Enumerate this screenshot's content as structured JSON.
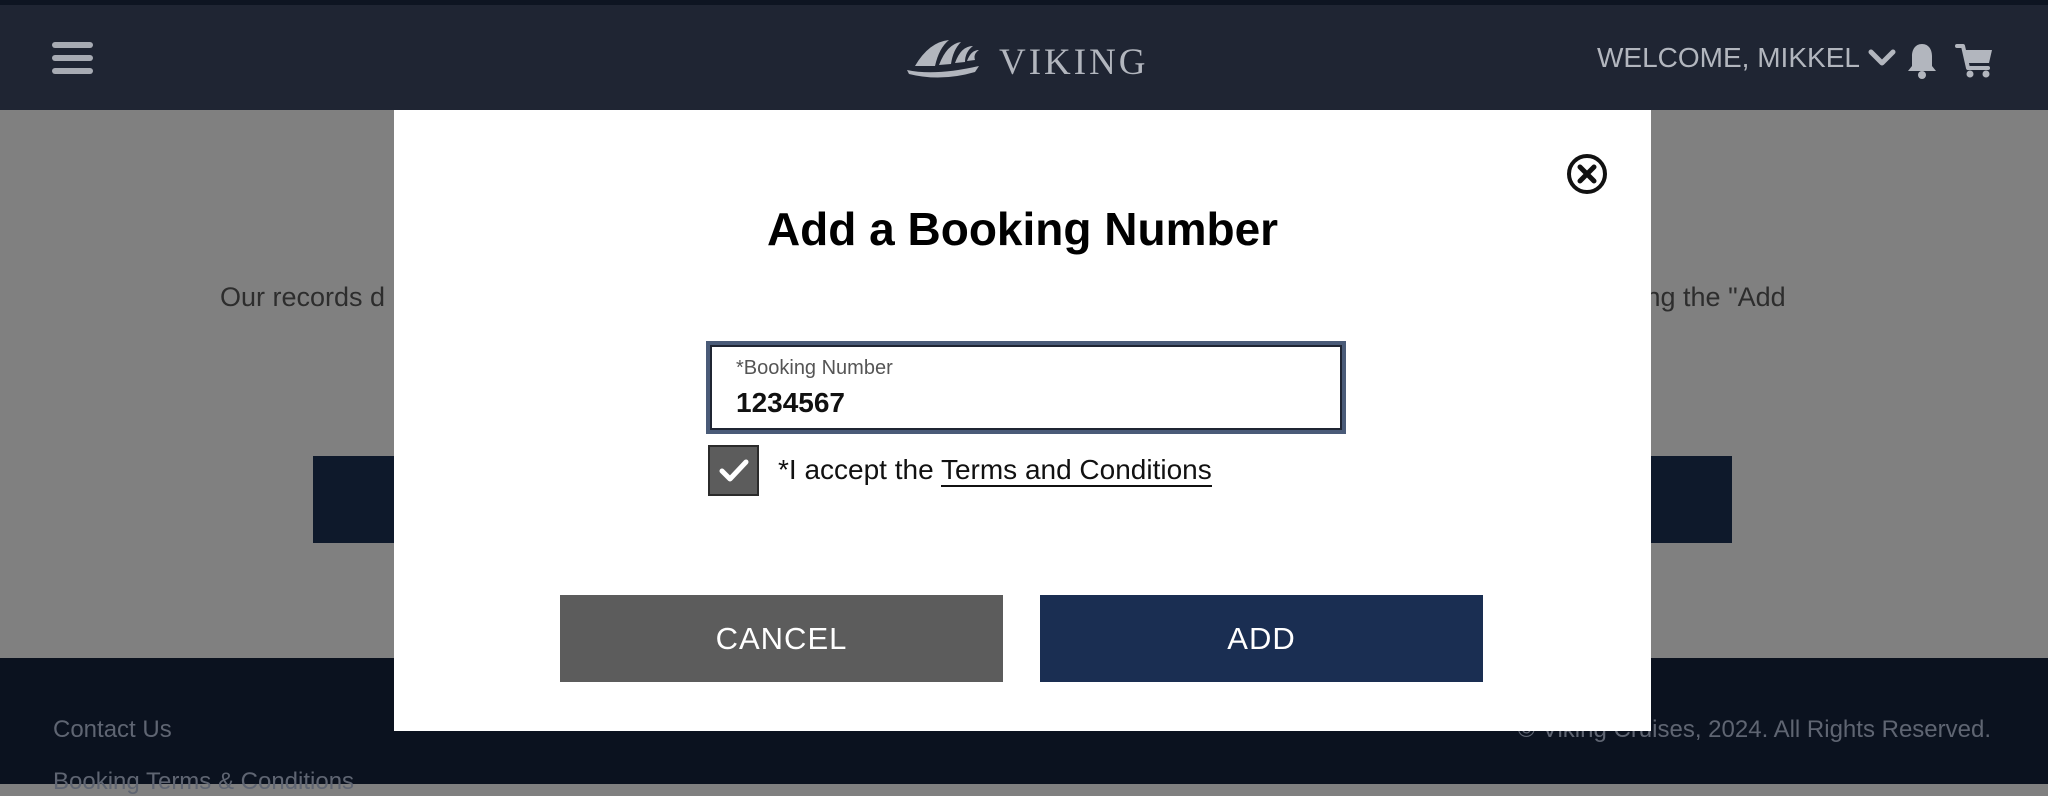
{
  "header": {
    "brand": "VIKING",
    "welcome": "WELCOME, MIKKEL"
  },
  "page": {
    "records_text_left": "Our records d",
    "records_text_right": "ting the \"Add"
  },
  "modal": {
    "title": "Add a Booking Number",
    "field_label": "*Booking Number",
    "field_value": "1234567",
    "accept_prefix": "*I accept the ",
    "terms_link": "Terms and Conditions",
    "checkbox_checked": true,
    "cancel_label": "CANCEL",
    "add_label": "ADD"
  },
  "footer": {
    "contact": "Contact Us",
    "booking_terms": "Booking Terms & Conditions",
    "copyright": "© Viking Cruises, 2024. All Rights Reserved."
  },
  "colors": {
    "header_bg": "#1f2533",
    "footer_bg": "#0b121f",
    "overlay": "#808080",
    "add_button": "#1a2e52",
    "cancel_button": "#5c5c5c"
  },
  "icons": {
    "menu": "hamburger-icon",
    "logo": "viking-ship-icon",
    "dropdown": "chevron-down-icon",
    "bell": "bell-icon",
    "cart": "cart-icon",
    "close": "close-circle-icon",
    "check": "checkmark-icon"
  }
}
